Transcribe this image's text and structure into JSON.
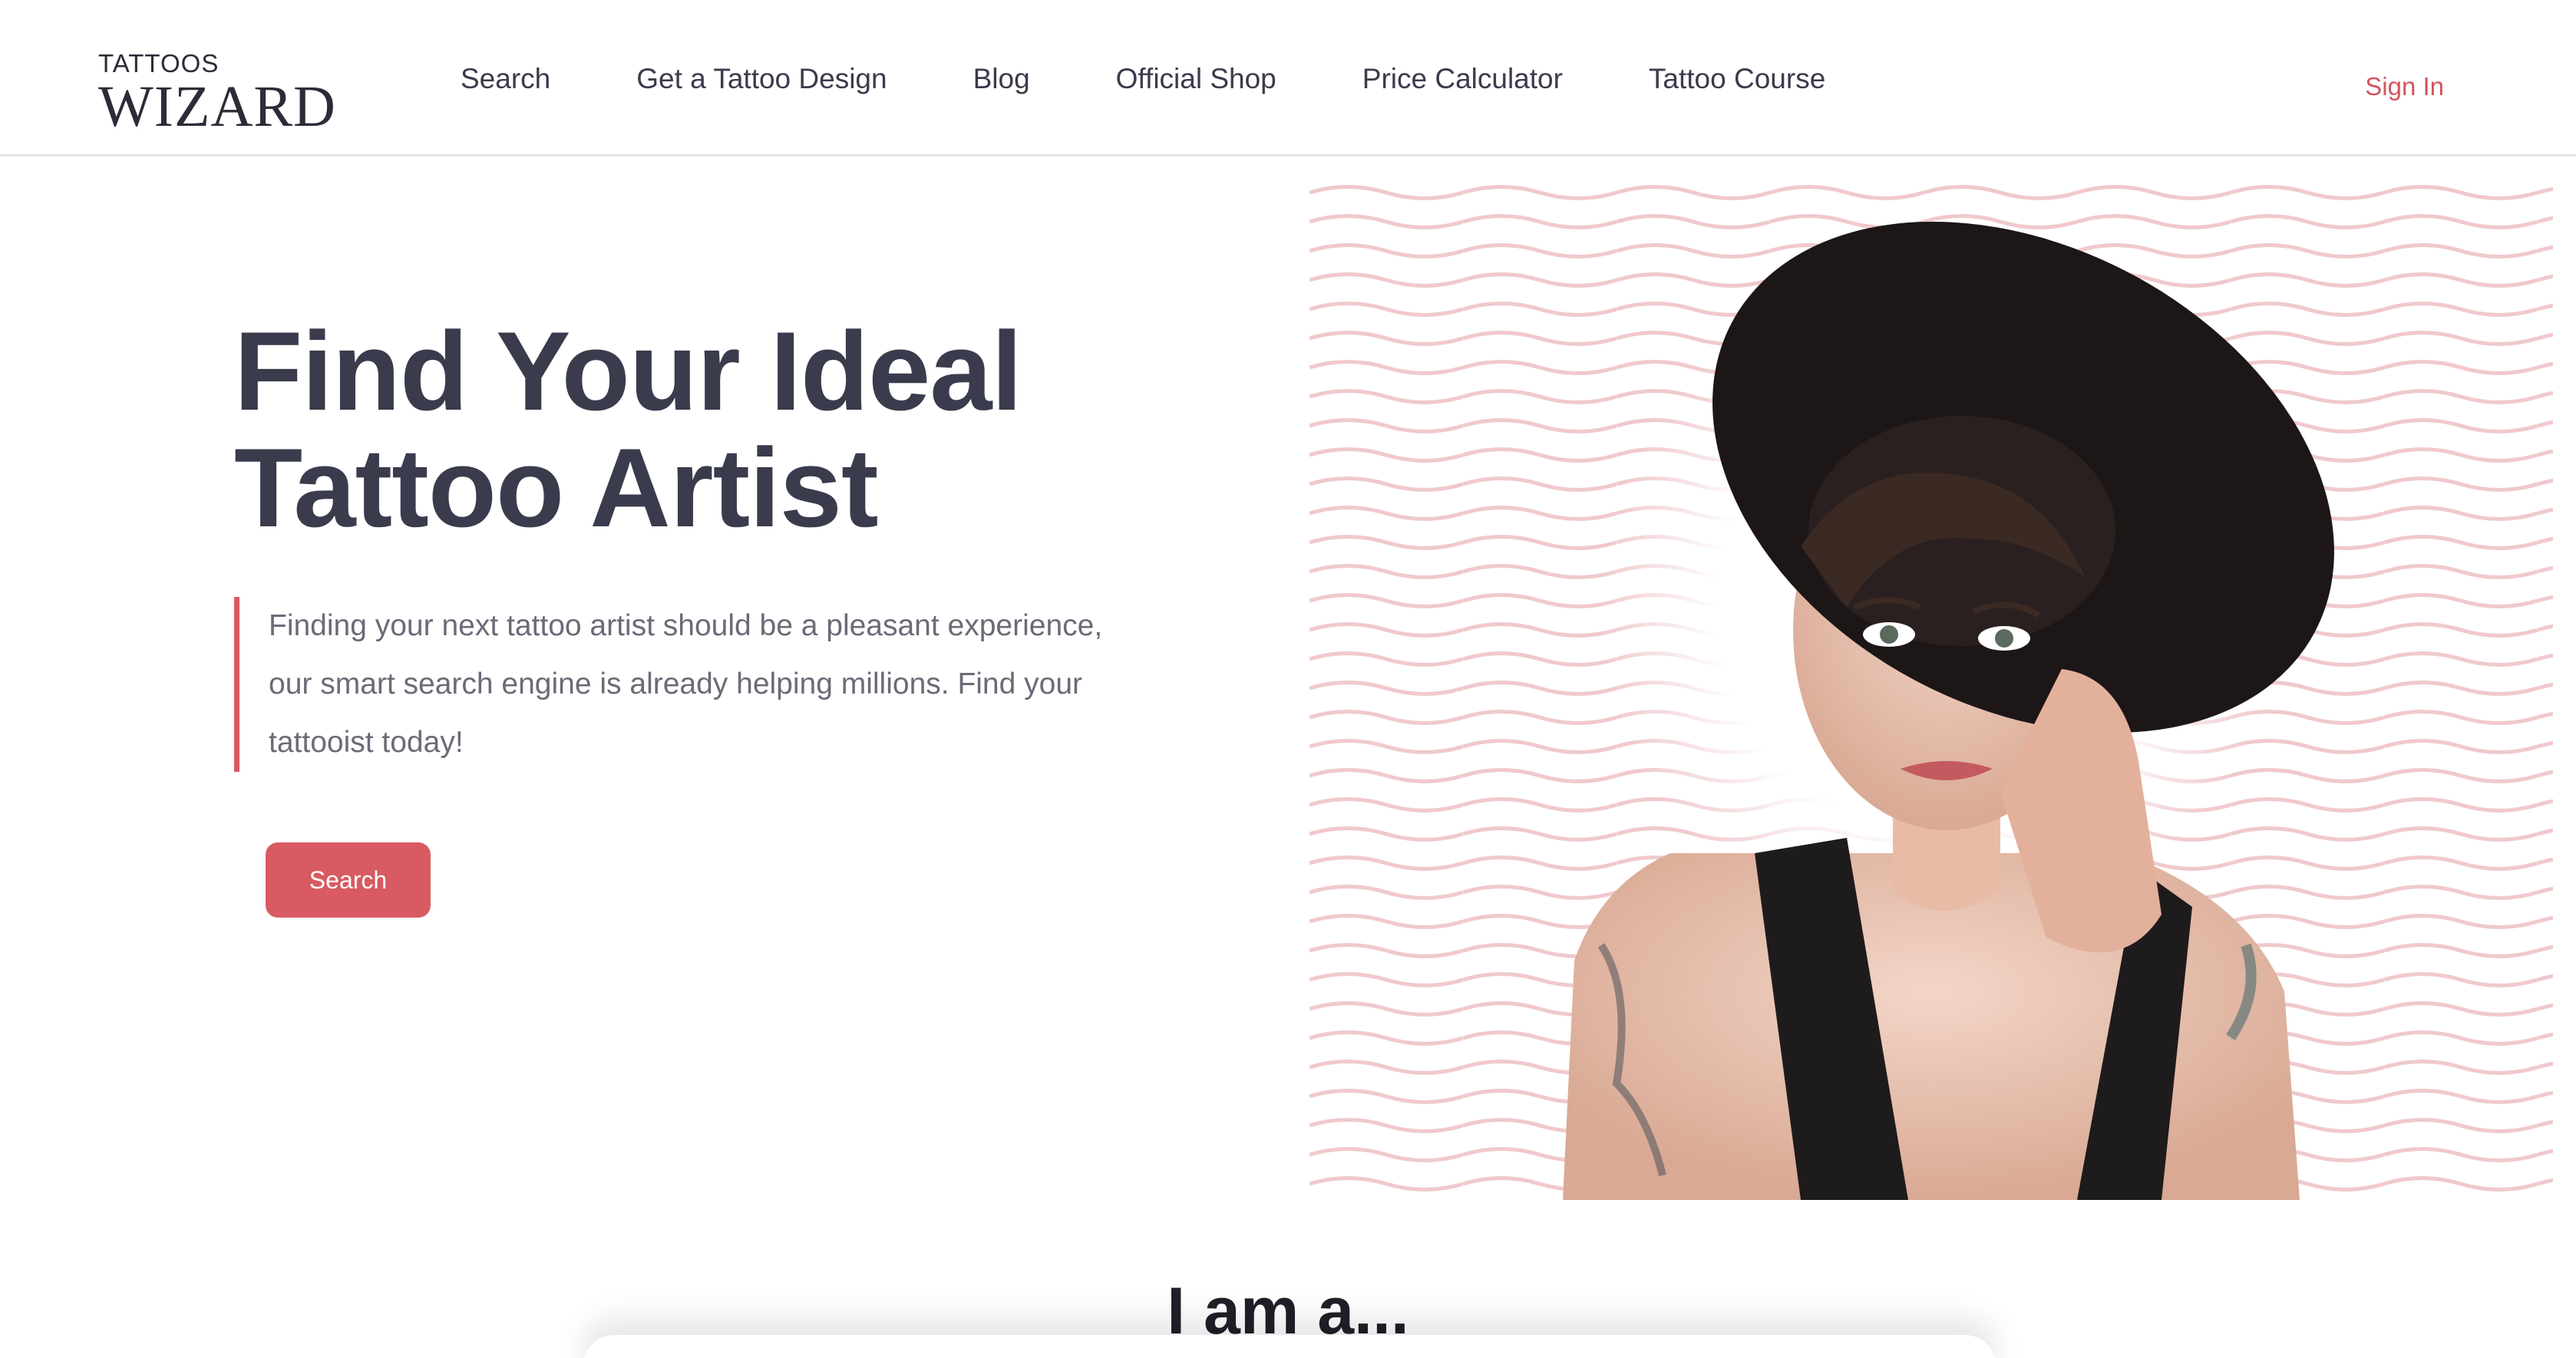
{
  "brand": {
    "small": "TATTOOS",
    "big": "WIZARD"
  },
  "nav": {
    "items": [
      {
        "label": "Search"
      },
      {
        "label": "Get a Tattoo Design"
      },
      {
        "label": "Blog"
      },
      {
        "label": "Official Shop"
      },
      {
        "label": "Price Calculator"
      },
      {
        "label": "Tattoo Course"
      }
    ],
    "signin": "Sign In"
  },
  "hero": {
    "title_line1": "Find Your Ideal",
    "title_line2": "Tattoo Artist",
    "description_line1": "Finding your next tattoo artist should be a pleasant experience,",
    "description_line2": "our smart search engine is already helping millions. Find your",
    "description_line3": "tattooist today!",
    "button": "Search"
  },
  "section": {
    "heading": "I am a..."
  },
  "colors": {
    "accent": "#d85a62",
    "text_dark": "#3a3b4c",
    "wave": "#f0c9cd"
  }
}
